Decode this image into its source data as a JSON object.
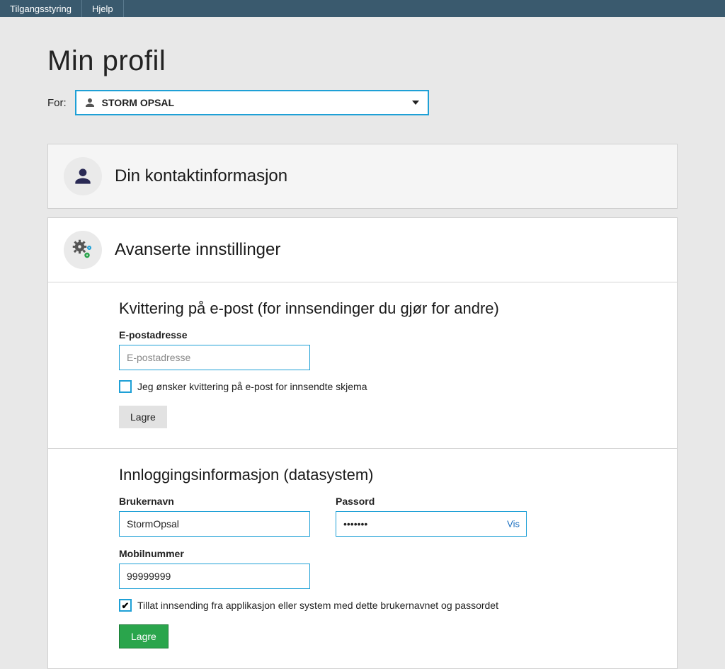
{
  "topbar": {
    "items": [
      "Tilgangsstyring",
      "Hjelp"
    ]
  },
  "page_title": "Min profil",
  "for_label": "For:",
  "user_select": {
    "name": "STORM OPSAL"
  },
  "contact_card": {
    "title": "Din kontaktinformasjon"
  },
  "advanced_card": {
    "title": "Avanserte innstillinger",
    "receipt": {
      "heading": "Kvittering på e-post (for innsendinger du gjør for andre)",
      "email_label": "E-postadresse",
      "email_placeholder": "E-postadresse",
      "email_value": "",
      "checkbox_label": "Jeg ønsker kvittering på e-post for innsendte skjema",
      "checkbox_checked": false,
      "save_label": "Lagre"
    },
    "login": {
      "heading": "Innloggingsinformasjon (datasystem)",
      "username_label": "Brukernavn",
      "username_value": "StormOpsal",
      "password_label": "Passord",
      "password_value": "•••••••",
      "show_label": "Vis",
      "mobile_label": "Mobilnummer",
      "mobile_value": "99999999",
      "allow_label": "Tillat innsending fra applikasjon eller system med dette brukernavnet og passordet",
      "allow_checked": true,
      "save_label": "Lagre"
    }
  }
}
